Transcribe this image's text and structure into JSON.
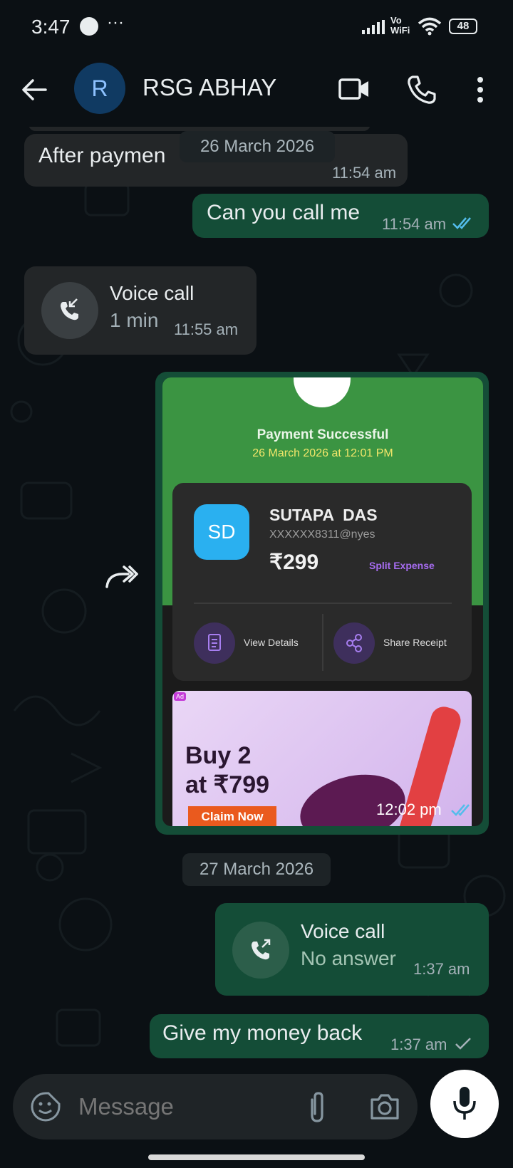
{
  "status": {
    "time": "3:47",
    "dots": "···",
    "vowifi_line1": "Vo",
    "vowifi_line2": "WiFi",
    "battery": "48"
  },
  "header": {
    "avatar_letter": "R",
    "name": "RSG ABHAY"
  },
  "messages": {
    "m1": {
      "text": "After paymen",
      "time": "11:54 am"
    },
    "date1": "26 March 2026",
    "m2": {
      "text": "Can you call me",
      "time": "11:54 am"
    },
    "m3": {
      "title": "Voice call",
      "subtitle": "1 min",
      "time": "11:55 am"
    },
    "m4": {
      "status": "Payment Successful",
      "datetime": "26 March 2026 at 12:01 PM",
      "initials": "SD",
      "payee": "SUTAPA  DAS",
      "upi": "XXXXXX8311@nyes",
      "amount": "₹299",
      "split": "Split Expense",
      "view_details": "View Details",
      "share_receipt": "Share Receipt",
      "ad_badge": "Ad",
      "ad_line1": "Buy 2",
      "ad_line2": "at ₹799",
      "ad_cta": "Claim Now",
      "time": "12:02 pm"
    },
    "date2": "27 March 2026",
    "m5": {
      "title": "Voice call",
      "subtitle": "No answer",
      "time": "1:37 am"
    },
    "m6": {
      "text": "Give my money back",
      "time": "1:37 am"
    }
  },
  "composer": {
    "placeholder": "Message"
  },
  "colors": {
    "outgoing": "#144d37",
    "incoming": "#232628",
    "tick_read": "#53bdeb",
    "payment_green": "#3b9442",
    "accent_purple": "#a66cf0"
  }
}
